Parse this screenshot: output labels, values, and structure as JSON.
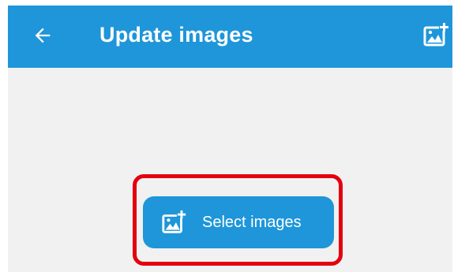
{
  "app_bar": {
    "title": "Update images",
    "back_icon": "arrow-left-icon",
    "action_icon": "add-image-icon",
    "background": "#1e96d9"
  },
  "main": {
    "background": "#f1f1f1",
    "select_button": {
      "label": "Select images",
      "icon": "add-image-icon",
      "background": "#1e96d9"
    },
    "highlight_color": "#e3000f"
  }
}
